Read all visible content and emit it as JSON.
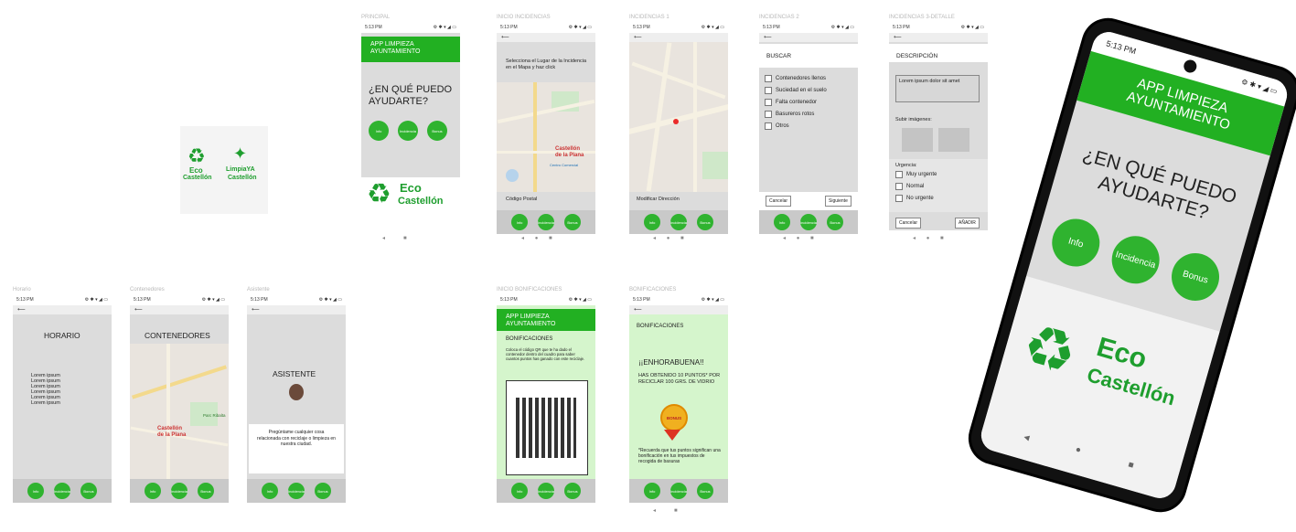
{
  "frame_labels": {
    "f2": "PRINCIPAL",
    "f3": "INICIO INCIDENCIAS",
    "f4": "INCIDENCIAS 1",
    "f5": "INCIDENCIAS 2",
    "f6": "INCIDENCIAS 3-DETALLE",
    "f7": "Horario",
    "f8": "Contenedores",
    "f9": "Asistente",
    "f10": "INICIO BONIFICACIONES",
    "f11": "BONIFICACIONES"
  },
  "status": {
    "time": "5:13 PM",
    "icons": "⚙ ✱ ▾ ◢ ▭"
  },
  "back_arrow": "⟵",
  "logo": {
    "eco": "Eco",
    "castellon": "Castellón",
    "limpia": "LimpiaYA",
    "limpia_sub": "Castellón"
  },
  "app": {
    "line1": "APP LIMPIEZA",
    "line2": "AYUNTAMIENTO",
    "question_1": "¿EN QUÉ PUEDO",
    "question_2": "AYUDARTE?"
  },
  "nav": {
    "info": "Info",
    "incidencia": "Incidencia",
    "bonus": "Bonus"
  },
  "softkeys": {
    "back": "◂",
    "home": "●",
    "recent": "■"
  },
  "inc_start": {
    "instruction": "Selecciona el Lugar de la Incidencia en el Mapa y haz click",
    "postal": "Código Postal"
  },
  "inc1": {
    "modify": "Modificar Dirección"
  },
  "inc2": {
    "title": "BUSCAR",
    "options": [
      "Contenedores llenos",
      "Suciedad en el suelo",
      "Falta contenedor",
      "Basureros rotos",
      "Otros"
    ],
    "cancel": "Cancelar",
    "next": "Siguiente"
  },
  "inc3": {
    "title": "DESCRIPCIÓN",
    "text": "Lorem ipsum dolor sit amet",
    "upload": "Subir imágenes:",
    "urgency": "Urgencia:",
    "levels": [
      "Muy urgente",
      "Normal",
      "No urgente"
    ],
    "cancel": "Cancelar",
    "add": "AÑADIR"
  },
  "horario": {
    "title": "HORARIO",
    "lines": [
      "Lorem ipsum",
      "Lorem ipsum",
      "Lorem ipsum",
      "Lorem ipsum",
      "Lorem ipsum",
      "Lorem ipsum"
    ]
  },
  "contenedores": {
    "title": "CONTENEDORES"
  },
  "map_labels": {
    "city1": "Castellón",
    "city2": "de la Plana",
    "park": "Parc Ribalta",
    "mall": "Centro Comercial",
    "ciudad": "Ciudad"
  },
  "asistente": {
    "title": "ASISTENTE",
    "msg": "Pregúntame cualquier cosa relacionada con reciclaje o limpieza en nuestra ciudad."
  },
  "bon_start": {
    "title": "BONIFICACIONES",
    "msg": "Coloca el código QR que te ha dado el contenedor dentro del cuadro para saber cuantos puntos has ganado con este reciclaje."
  },
  "bon": {
    "title": "BONIFICACIONES",
    "congrats": "¡¡ENHORABUENA!!",
    "points": "HAS OBTENIDO 10 PUNTOS* POR RECICLAR 100 GRS. DE VIDRIO",
    "badge": "BONUS",
    "note": "*Recuerda que tus puntos significan una bonificación en tus impuestos de recogida de basuras"
  },
  "colors": {
    "green": "#22b022",
    "circle": "#2fb32f",
    "screen_grey": "#dcdcdc",
    "light_green": "#d5f5cc"
  }
}
